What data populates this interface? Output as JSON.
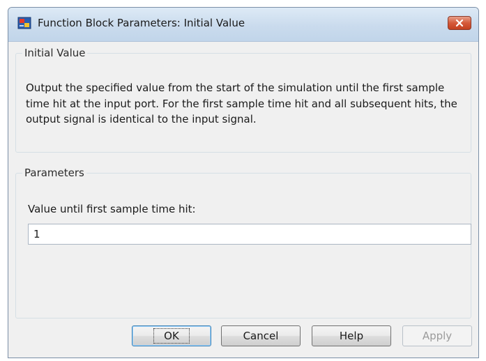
{
  "window": {
    "title": "Function Block Parameters: Initial Value"
  },
  "block_info": {
    "group_label": "Initial Value",
    "description": "Output the specified value from the start of the simulation until the first sample time hit at the input port. For the first sample time hit and all subsequent hits, the output signal is identical to the input signal."
  },
  "parameters": {
    "group_label": "Parameters",
    "value_label": "Value until first sample time hit:",
    "value": "1"
  },
  "buttons": {
    "ok": "OK",
    "cancel": "Cancel",
    "help": "Help",
    "apply": "Apply",
    "apply_enabled": false
  },
  "icons": {
    "app": "simulink-block-icon",
    "close": "close-icon"
  },
  "colors": {
    "close_button": "#d55a3a",
    "focus_border": "#3c7fb1"
  }
}
